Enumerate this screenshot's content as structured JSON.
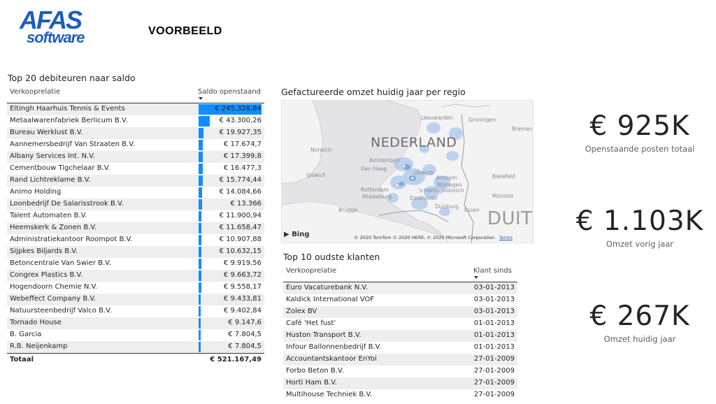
{
  "header": {
    "logo_line1": "AFAS",
    "logo_line2": "software",
    "report_title": "VOORBEELD"
  },
  "debtors": {
    "title": "Top 20 debiteuren naar saldo",
    "col_name": "Verkooprelatie",
    "col_value": "Saldo openstaand",
    "max_value": 245328.84,
    "rows": [
      {
        "name": "Eltingh Haarhuis Tennis & Events",
        "display": "€ 245.328,84",
        "value": 245328.84
      },
      {
        "name": "Metaalwarenfabriek Berlicum B.V.",
        "display": "€ 43.300,26",
        "value": 43300.26
      },
      {
        "name": "Bureau Werklust B.V.",
        "display": "€ 19.927,35",
        "value": 19927.35
      },
      {
        "name": "Aannemersbedrijf Van Straaten B.V.",
        "display": "€ 17.674,7",
        "value": 17674.7
      },
      {
        "name": "Albany Services Int. N.V.",
        "display": "€ 17.399,8",
        "value": 17399.8
      },
      {
        "name": "Cementbouw Tigchelaar B.V.",
        "display": "€ 16.477,3",
        "value": 16477.3
      },
      {
        "name": "Rand Lichtreklame B.V.",
        "display": "€ 15.774,44",
        "value": 15774.44
      },
      {
        "name": "Animo Holding",
        "display": "€ 14.084,66",
        "value": 14084.66
      },
      {
        "name": "Loonbedrijf De Salarisstrook B.V.",
        "display": "€ 13.366",
        "value": 13366
      },
      {
        "name": "Talent Automaten B.V.",
        "display": "€ 11.900,94",
        "value": 11900.94
      },
      {
        "name": "Heemskerk & Zonen B.V.",
        "display": "€ 11.658,47",
        "value": 11658.47
      },
      {
        "name": "Administratiekantoor Roompot B.V.",
        "display": "€ 10.907,88",
        "value": 10907.88
      },
      {
        "name": "Sijpkes Biljards B.V.",
        "display": "€ 10.632,15",
        "value": 10632.15
      },
      {
        "name": "Betoncentrale Van Swier B.V.",
        "display": "€ 9.919,56",
        "value": 9919.56
      },
      {
        "name": "Congrex Plastics B.V.",
        "display": "€ 9.663,72",
        "value": 9663.72
      },
      {
        "name": "Hogendoorn Chemie N.V.",
        "display": "€ 9.558,17",
        "value": 9558.17
      },
      {
        "name": "Webeffect Company B.V.",
        "display": "€ 9.433,81",
        "value": 9433.81
      },
      {
        "name": "Natuursteenbedrijf Valco B.V.",
        "display": "€ 9.402,84",
        "value": 9402.84
      },
      {
        "name": "Tornado House",
        "display": "€ 9.147,6",
        "value": 9147.6
      },
      {
        "name": "B. Garcia",
        "display": "€ 7.804,5",
        "value": 7804.5
      },
      {
        "name": "R.B. Neijenkamp",
        "display": "€ 7.804,5",
        "value": 7804.5
      }
    ],
    "total_label": "Totaal",
    "total_value": "€ 521.167,49"
  },
  "map": {
    "title": "Gefactureerde omzet huidig jaar per regio",
    "country_label": "NEDERLAND",
    "country_label_2": "DUIT",
    "places": [
      "Leeuwarden",
      "Groningen",
      "Bremen",
      "Norwich",
      "Amsterdam",
      "Den Haag",
      "Utrecht",
      "Ipswich",
      "Rotterdam",
      "Arnhem",
      "Bielefeld",
      "Nijmegen",
      "Münster",
      "Middelburg",
      "Eindhoven",
      "'s-Hertogenbosch",
      "Brugge",
      "Duisburg",
      "Essen"
    ],
    "bing_label": "Bing",
    "copyright": "© 2020 TomTom © 2020 HERE, © 2020 Microsoft Corporation",
    "terms": "Terms"
  },
  "customers": {
    "title": "Top 10 oudste klanten",
    "col_name": "Verkooprelatie",
    "col_value": "Klant sinds",
    "rows": [
      {
        "name": "Euro Vacaturebank N.V.",
        "date": "03-01-2013"
      },
      {
        "name": "Kaldick International VOF",
        "date": "03-01-2013"
      },
      {
        "name": "Zolex BV",
        "date": "03-01-2013"
      },
      {
        "name": "Café 'Het fust'",
        "date": "01-01-2013"
      },
      {
        "name": "Huston Transport B.V.",
        "date": "01-01-2013"
      },
      {
        "name": "Infour Ballonnenbedrijf B.V.",
        "date": "01-01-2013"
      },
      {
        "name": "Accountantskantoor EnYoi",
        "date": "27-01-2009"
      },
      {
        "name": "Forbo Beton B.V.",
        "date": "27-01-2009"
      },
      {
        "name": "Horti Ham B.V.",
        "date": "27-01-2009"
      },
      {
        "name": "Multihouse Techniek B.V.",
        "date": "27-01-2009"
      }
    ]
  },
  "kpis": [
    {
      "value": "€ 925K",
      "label": "Openstaande posten totaal"
    },
    {
      "value": "€ 1.103K",
      "label": "Omzet vorig jaar"
    },
    {
      "value": "€ 267K",
      "label": "Omzet huidig jaar"
    }
  ],
  "colors": {
    "accent_bar": "#118dff",
    "logo_blue": "#1e5dbf",
    "row_shade": "#eeeeee"
  }
}
